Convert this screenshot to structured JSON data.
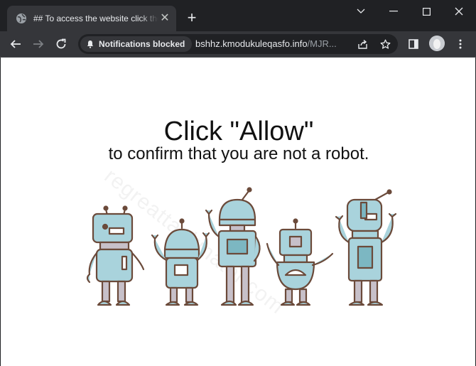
{
  "tab": {
    "title": "## To access the website click the",
    "icon": "globe-icon"
  },
  "window_controls": [
    "chevron-down-icon",
    "minimize-icon",
    "maximize-icon",
    "close-icon"
  ],
  "toolbar": {
    "chip_label": "Notifications blocked",
    "url_domain": "bshhz.kmodukuleqasfo.info",
    "url_path": "/MJR..."
  },
  "page": {
    "headline": "Click \"Allow\"",
    "subline": "to confirm that you are not a robot.",
    "watermark": "regreattankinator.com"
  },
  "colors": {
    "frame": "#202124",
    "toolbar": "#35363a",
    "robot_fill": "#a9d3dc",
    "robot_stroke": "#6b4a3a"
  }
}
